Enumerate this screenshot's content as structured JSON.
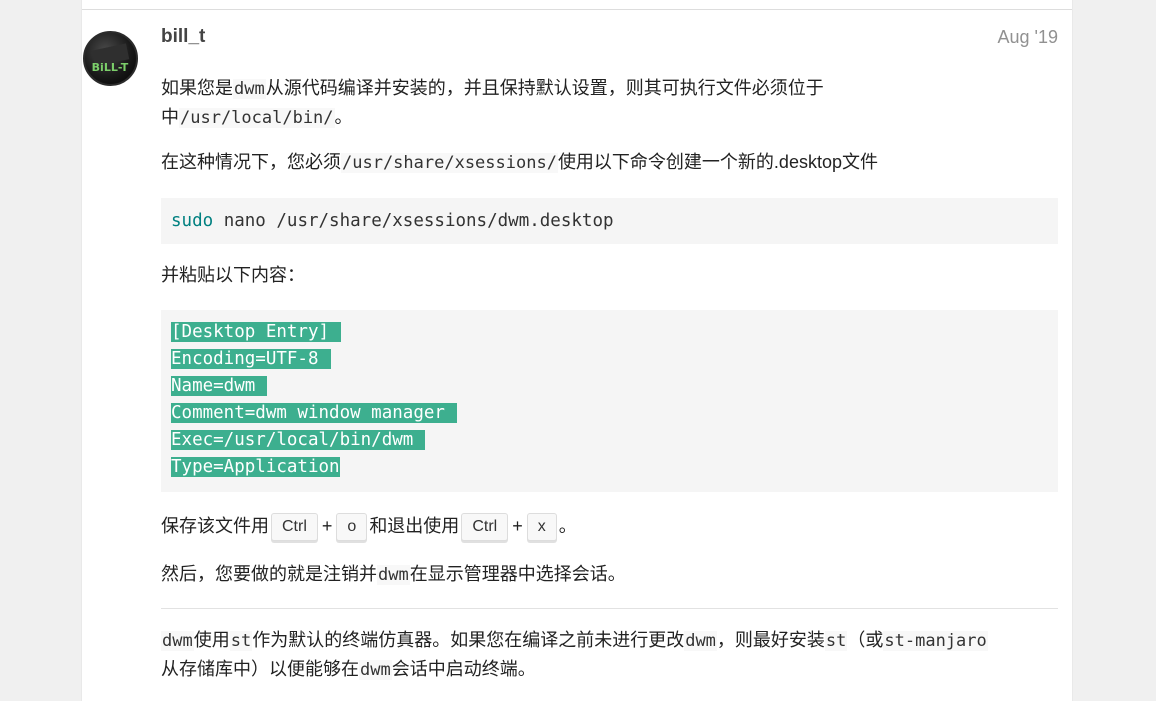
{
  "post": {
    "username": "bill_t",
    "date": "Aug '19",
    "avatar_text": "BiLL-T"
  },
  "p1": {
    "t1": "如果您是",
    "c1": "dwm",
    "t2": "从源代码编译并安装的，并且保持默认设置，则其可执行文件必须位于中",
    "c2": "/usr/local/bin/",
    "t3": "。"
  },
  "p2": {
    "t1": "在这种情况下，您必须",
    "c1": "/usr/share/xsessions/",
    "t2": "使用以下命令创建一个新的.desktop文件"
  },
  "command": {
    "keyword": "sudo",
    "rest": " nano /usr/share/xsessions/dwm.desktop"
  },
  "p3": {
    "text": "并粘贴以下内容："
  },
  "desktop_file": {
    "lines": [
      "[Desktop Entry]",
      "Encoding=UTF-8",
      "Name=dwm",
      "Comment=dwm window manager",
      "Exec=/usr/local/bin/dwm",
      "Type=Application"
    ]
  },
  "p4": {
    "t1": "保存该文件用",
    "k1": "Ctrl",
    "plus1": "+",
    "k2": "o",
    "t2": "和退出使用",
    "k3": "Ctrl",
    "plus2": "+",
    "k4": "x",
    "t3": "。"
  },
  "p5": {
    "t1": "然后，您要做的就是注销并",
    "c1": "dwm",
    "t2": "在显示管理器中选择会话。"
  },
  "p6": {
    "c1": "dwm",
    "t1": "使用",
    "c2": "st",
    "t2": "作为默认的终端仿真器。如果您在编译之前未进行更改",
    "c3": "dwm",
    "t3": "，则最好安装",
    "c4": "st",
    "t4": "（或",
    "c5": "st-manjaro",
    "t5": "从存储库中）以便能够在",
    "c6": "dwm",
    "t6": "会话中启动终端。"
  },
  "colors": {
    "selection": "#3daf8f",
    "code_keyword": "#008080",
    "code_bg": "#f5f5f5",
    "date": "#919191"
  }
}
